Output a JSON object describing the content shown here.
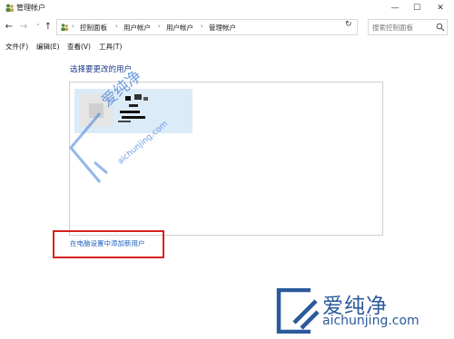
{
  "window": {
    "title": "管理帐户",
    "minimize_glyph": "—",
    "maximize_glyph": "☐",
    "close_glyph": "✕"
  },
  "nav": {
    "back_glyph": "←",
    "forward_glyph": "→",
    "dropdown_glyph": "˅",
    "up_glyph": "↑",
    "refresh_glyph": "↻",
    "breadcrumb_sep": "›",
    "breadcrumb": [
      "控制面板",
      "用户帐户",
      "用户帐户",
      "管理帐户"
    ]
  },
  "search": {
    "placeholder": "搜索控制面板"
  },
  "menu": {
    "items": [
      "文件(F)",
      "编辑(E)",
      "查看(V)",
      "工具(T)"
    ]
  },
  "content": {
    "section_title": "选择要更改的用户",
    "add_user_link": "在电脑设置中添加新用户"
  },
  "watermark": {
    "brand_cn": "爱纯净",
    "brand_url": "aichunjing.com",
    "center_cn": "爱纯净",
    "center_url": "aichunjing.com"
  },
  "colors": {
    "accent_link": "#1f5fbf",
    "tile_bg": "#dcebf8",
    "highlight_red": "#d62020",
    "watermark_blue": "#2b5a9b"
  }
}
